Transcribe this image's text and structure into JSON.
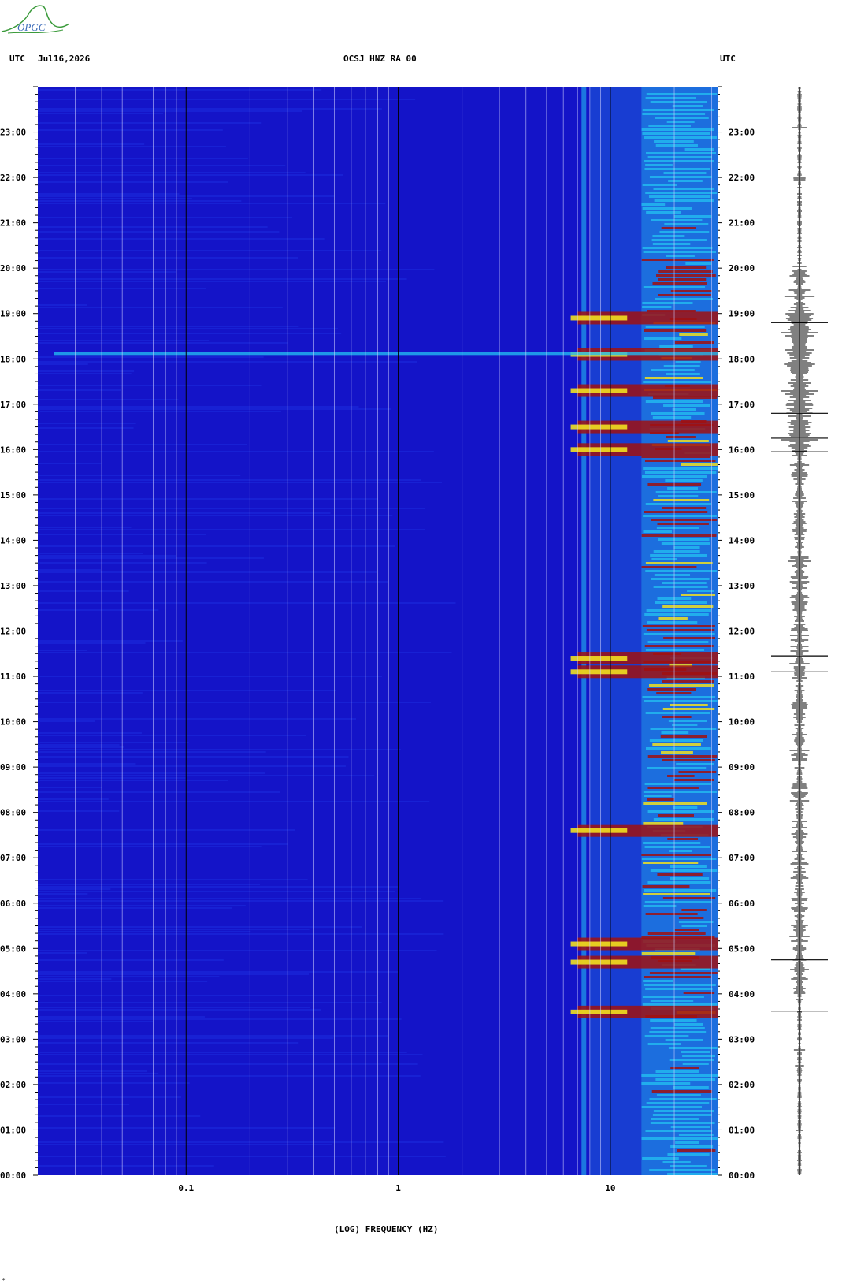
{
  "header": {
    "left_utc": "UTC",
    "date": "Jul16,2026",
    "station": "OCSJ HNZ RA 00",
    "right_utc": "UTC"
  },
  "logo": {
    "text": "OPGC",
    "color": "#3a9a3a"
  },
  "colors": {
    "background": "#1414c8",
    "low": "#1c2ee0",
    "mid": "#22b8f0",
    "high": "#f0e020",
    "peak": "#a01010"
  },
  "corner_mark": "*",
  "chart_data": {
    "type": "heatmap",
    "title": "OCSJ HNZ RA 00",
    "xlabel": "(LOG) FREQUENCY (HZ)",
    "ylabel": "UTC",
    "x_scale": "log",
    "xlim_hz": [
      0.02,
      32
    ],
    "x_tick_labels": [
      "0.1",
      "1",
      "10"
    ],
    "x_tick_values": [
      0.1,
      1,
      10
    ],
    "grid_lines_hz": [
      0.03,
      0.04,
      0.05,
      0.06,
      0.07,
      0.08,
      0.09,
      0.2,
      0.3,
      0.4,
      0.5,
      0.6,
      0.7,
      0.8,
      0.9,
      2,
      3,
      4,
      5,
      6,
      7,
      8,
      9,
      20,
      30
    ],
    "ylim_hours": [
      0,
      24
    ],
    "y_tick_labels": [
      "00:00",
      "01:00",
      "02:00",
      "03:00",
      "04:00",
      "05:00",
      "06:00",
      "07:00",
      "08:00",
      "09:00",
      "10:00",
      "11:00",
      "12:00",
      "13:00",
      "14:00",
      "15:00",
      "16:00",
      "17:00",
      "18:00",
      "19:00",
      "20:00",
      "21:00",
      "22:00",
      "23:00"
    ],
    "high_energy_band_hz": [
      14,
      32
    ],
    "persistent_line_hz": 7.5,
    "strong_events_hours": [
      3.6,
      4.7,
      5.1,
      7.6,
      11.1,
      11.4,
      16.0,
      16.5,
      17.3,
      18.1,
      18.9
    ],
    "seismogram_large_spikes_hours": [
      3.62,
      4.75,
      11.1,
      11.45,
      15.95,
      16.25,
      16.8,
      18.8
    ]
  }
}
